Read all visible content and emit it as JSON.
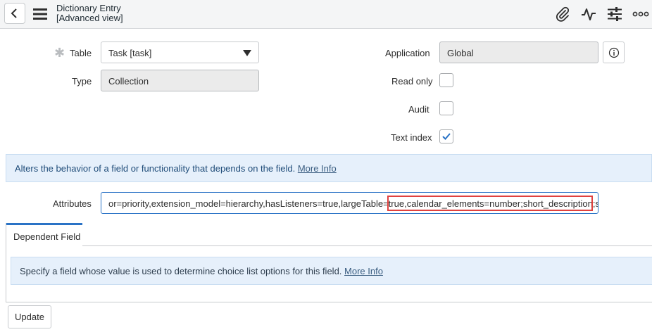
{
  "header": {
    "title": "Dictionary Entry",
    "subtitle": "[Advanced view]",
    "icons": [
      "back-icon",
      "hamburger-menu-icon",
      "paperclip-icon",
      "activity-icon",
      "settings-sliders-icon",
      "more-options-icon"
    ]
  },
  "form": {
    "table": {
      "label": "Table",
      "value": "Task [task]"
    },
    "type": {
      "label": "Type",
      "value": "Collection"
    },
    "application": {
      "label": "Application",
      "value": "Global"
    },
    "read_only": {
      "label": "Read only",
      "checked": false
    },
    "audit": {
      "label": "Audit",
      "checked": false
    },
    "text_index": {
      "label": "Text index",
      "checked": true
    },
    "attributes": {
      "label": "Attributes",
      "value": "or=priority,extension_model=hierarchy,hasListeners=true,largeTable=true,calendar_elements=number;short_description;state"
    }
  },
  "info_messages": [
    {
      "text": "Alters the behavior of a field or functionality that depends on the field.",
      "link": "More Info"
    },
    {
      "text": "Specify a field whose value is used to determine choice list options for this field.",
      "link": "More Info"
    }
  ],
  "tabs": [
    {
      "label": "Dependent Field",
      "active": true
    }
  ],
  "actions": {
    "update_label": "Update"
  },
  "colors": {
    "accent": "#2a73c6",
    "highlight": "#e0413f",
    "info_bg": "#e6f0fb"
  }
}
